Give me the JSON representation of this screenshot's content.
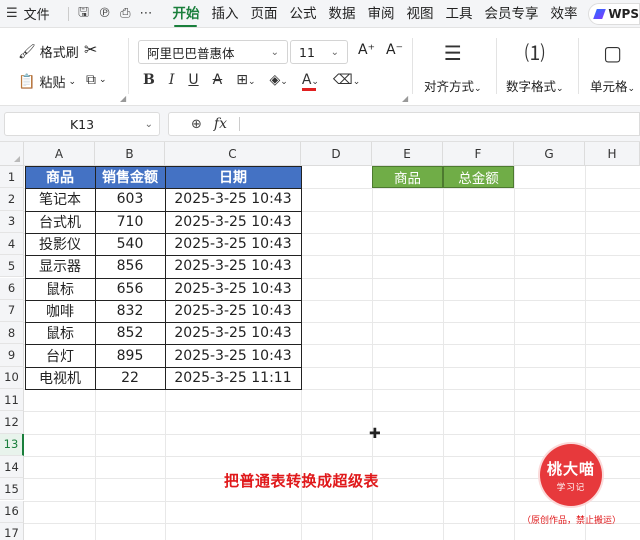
{
  "menubar": {
    "file_label": "文件",
    "tabs": [
      "开始",
      "插入",
      "页面",
      "公式",
      "数据",
      "审阅",
      "视图",
      "工具",
      "会员专享",
      "效率"
    ],
    "active_tab": "开始",
    "brand": "WPS"
  },
  "ribbon": {
    "format_painter": "格式刷",
    "paste": "粘贴",
    "font_name": "阿里巴巴普惠体",
    "font_size": "11",
    "bold": "B",
    "italic": "I",
    "underline": "U",
    "strikethrough": "A",
    "align_label": "对齐方式",
    "number_format_label": "数字格式",
    "cell_label": "单元格",
    "font_color": "#e02020"
  },
  "formula_bar": {
    "name_box": "K13",
    "fx_label": "fx",
    "value": ""
  },
  "sheet": {
    "columns": [
      "A",
      "B",
      "C",
      "D",
      "E",
      "F",
      "G",
      "H"
    ],
    "rows": [
      "1",
      "2",
      "3",
      "4",
      "5",
      "6",
      "7",
      "8",
      "9",
      "10",
      "11",
      "12",
      "13",
      "14",
      "15",
      "16",
      "17"
    ],
    "selected_row": "13",
    "table_headers": [
      "商品",
      "销售金额",
      "日期"
    ],
    "table_rows": [
      [
        "笔记本",
        "603",
        "2025-3-25 10:43"
      ],
      [
        "台式机",
        "710",
        "2025-3-25 10:43"
      ],
      [
        "投影仪",
        "540",
        "2025-3-25 10:43"
      ],
      [
        "显示器",
        "856",
        "2025-3-25 10:43"
      ],
      [
        "鼠标",
        "656",
        "2025-3-25 10:43"
      ],
      [
        "咖啡",
        "832",
        "2025-3-25 10:43"
      ],
      [
        "鼠标",
        "852",
        "2025-3-25 10:43"
      ],
      [
        "台灯",
        "895",
        "2025-3-25 10:43"
      ],
      [
        "电视机",
        "22",
        "2025-3-25 11:11"
      ]
    ],
    "side_headers": [
      "商品",
      "总金额"
    ],
    "header_color": "#4472c4",
    "side_header_color": "#70ad47"
  },
  "overlay": {
    "caption": "把普通表转换成超级表",
    "badge_title": "桃大喵",
    "badge_sub": "学习记",
    "note": "（原创作品，禁止搬运）",
    "caption_color": "#e0191b"
  }
}
